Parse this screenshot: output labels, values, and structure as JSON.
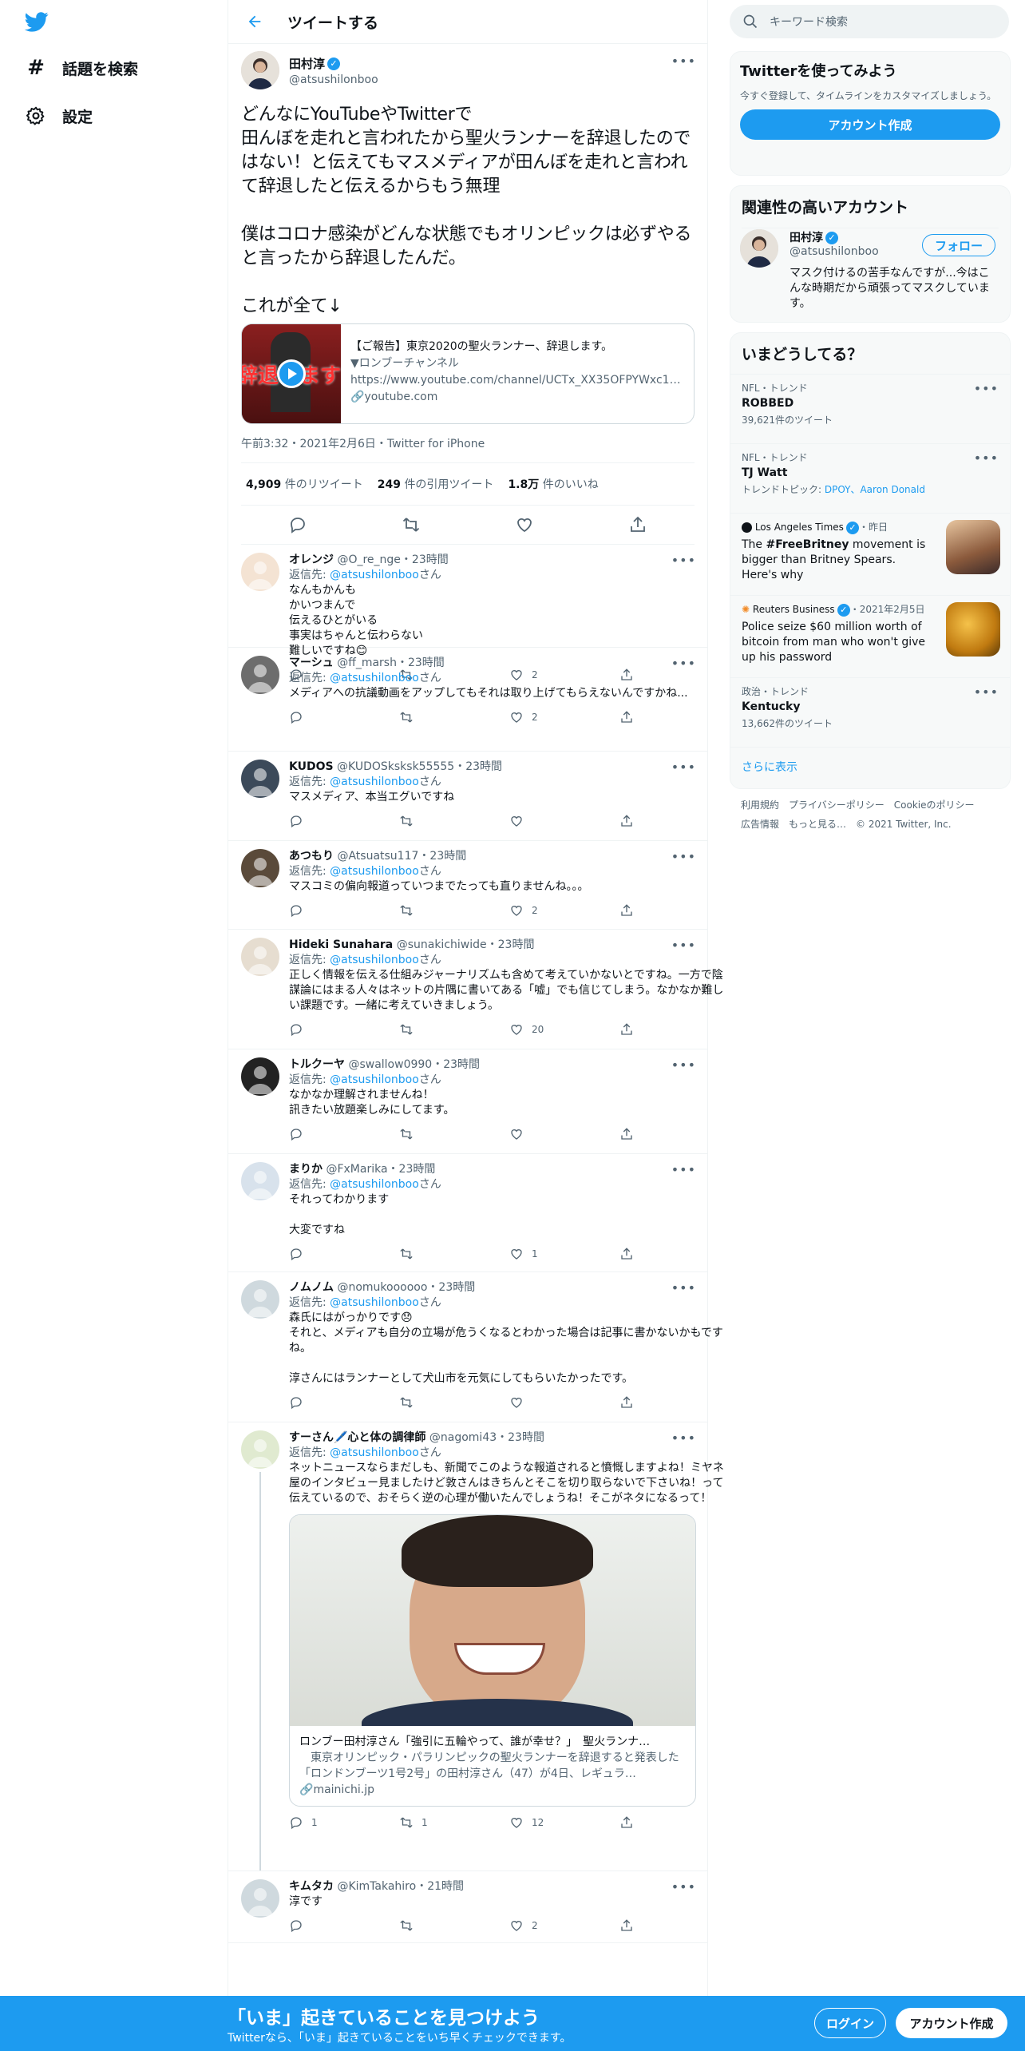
{
  "nav": {
    "explore_label": "話題を検索",
    "settings_label": "設定"
  },
  "header": {
    "title": "ツイートする"
  },
  "main_tweet": {
    "name": "田村淳",
    "handle": "@atsushilonboo",
    "text": "どんなにYouTubeやTwitterで\n田んぼを走れと言われたから聖火ランナーを辞退したのではない！と伝えてもマスメディアが田んぼを走れと言われて辞退したと伝えるからもう無理\n\n僕はコロナ感染がどんな状態でもオリンピックは必ずやると言ったから辞退したんだ。\n\nこれが全て↓",
    "card": {
      "title": "【ご報告】東京2020の聖火ランナー、辞退します。",
      "channel": "▼ロンブーチャンネル",
      "url": "https://www.youtube.com/channel/UCTx_XX35OFPYWxc1qQ…",
      "domain": "youtube.com",
      "thumb_text": "辞退します"
    },
    "meta": "午前3:32・2021年2月6日・Twitter for iPhone",
    "retweets_count": "4,909",
    "retweets_label": "件のリツイート",
    "quotes_count": "249",
    "quotes_label": "件の引用ツイート",
    "likes_count": "1.8万",
    "likes_label": "件のいいね"
  },
  "replies": [
    {
      "name": "オレンジ",
      "handle": "@O_re_nge",
      "time": "・23時間",
      "reply_to": "@atsushilonboo",
      "reply_suffix": "さん",
      "text": "なんもかんも\nかいつまんで\n伝えるひとがいる\n事実はちゃんと伝わらない\n難しいですね😊",
      "comments": "",
      "retweets": "",
      "likes": "2"
    },
    {
      "name": "マーシュ",
      "handle": "@ff_marsh",
      "time": "・23時間",
      "reply_to": "@atsushilonboo",
      "reply_suffix": "さん",
      "text": "メディアへの抗議動画をアップしてもそれは取り上げてもらえないんですかね...",
      "comments": "",
      "retweets": "",
      "likes": "2"
    },
    {
      "name": "KUDOS",
      "handle": "@KUDOSksksk55555",
      "time": "・23時間",
      "reply_to": "@atsushilonboo",
      "reply_suffix": "さん",
      "text": "マスメディア、本当エグいですね",
      "comments": "",
      "retweets": "",
      "likes": ""
    },
    {
      "name": "あつもり",
      "handle": "@Atsuatsu117",
      "time": "・23時間",
      "reply_to": "@atsushilonboo",
      "reply_suffix": "さん",
      "text": "マスコミの偏向報道っていつまでたっても直りませんね。。。",
      "comments": "",
      "retweets": "",
      "likes": "2"
    },
    {
      "name": "Hideki Sunahara",
      "handle": "@sunakichiwide",
      "time": "・23時間",
      "reply_to": "@atsushilonboo",
      "reply_suffix": "さん",
      "text": "正しく情報を伝える仕組みジャーナリズムも含めて考えていかないとですね。一方で陰謀論にはまる人々はネットの片隅に書いてある「嘘」でも信じてしまう。なかなか難しい課題です。一緒に考えていきましょう。",
      "comments": "",
      "retweets": "",
      "likes": "20"
    },
    {
      "name": "トルクーヤ",
      "handle": "@swallow0990",
      "time": "・23時間",
      "reply_to": "@atsushilonboo",
      "reply_suffix": "さん",
      "text": "なかなか理解されませんね！\n訊きたい放題楽しみにしてます。",
      "comments": "",
      "retweets": "",
      "likes": ""
    },
    {
      "name": "まりか",
      "handle": "@FxMarika",
      "time": "・23時間",
      "reply_to": "@atsushilonboo",
      "reply_suffix": "さん",
      "text": "それってわかります\n\n大変ですね",
      "comments": "",
      "retweets": "",
      "likes": "1"
    },
    {
      "name": "ノムノム",
      "handle": "@nomukoooooo",
      "time": "・23時間",
      "reply_to": "@atsushilonboo",
      "reply_suffix": "さん",
      "text": "森氏にはがっかりです😞\nそれと、メディアも自分の立場が危うくなるとわかった場合は記事に書かないかもですね。\n\n淳さんにはランナーとして犬山市を元気にしてもらいたかったです。",
      "comments": "",
      "retweets": "",
      "likes": ""
    },
    {
      "name": "すーさん🖊️心と体の調律師",
      "handle": "@nagomi43",
      "time": "・23時間",
      "reply_to": "@atsushilonboo",
      "reply_suffix": "さん",
      "text": "ネットニュースならまだしも、新聞でこのような報道されると憤慨しますよね！ミヤネ屋のインタビュー見ましたけど敦さんはきちんとそこを切り取らないで下さいね！って伝えているので、おそらく逆の心理が働いたんでしょうね！そこがネタになるって！",
      "comments": "1",
      "retweets": "1",
      "likes": "12",
      "card": {
        "title": "ロンブー田村淳さん「強引に五輪やって、誰が幸せ？」　聖火ランナ…",
        "desc": "　東京オリンピック・パラリンピックの聖火ランナーを辞退すると発表した「ロンドンブーツ1号2号」の田村淳さん（47）が4日、レギュラ…",
        "domain": "mainichi.jp"
      }
    },
    {
      "name": "キムタカ",
      "handle": "@KimTakahiro",
      "time": "・21時間",
      "reply_to": "",
      "reply_suffix": "",
      "text": "淳です",
      "comments": "",
      "retweets": "",
      "likes": "2"
    }
  ],
  "side": {
    "search_placeholder": "キーワード検索",
    "signup": {
      "title": "Twitterを使ってみよう",
      "desc": "今すぐ登録して、タイムラインをカスタマイズしましょう。",
      "button": "アカウント作成"
    },
    "related": {
      "title": "関連性の高いアカウント",
      "name": "田村淳",
      "handle": "@atsushilonboo",
      "follow": "フォロー",
      "bio": "マスク付けるの苦手なんですが...今はこんな時期だから頑張ってマスクしています。"
    },
    "trends": {
      "title": "いまどうしてる？",
      "items": [
        {
          "cat": "NFL・トレンド",
          "title": "ROBBED",
          "sub": "39,621件のツイート"
        },
        {
          "cat": "NFL・トレンド",
          "title": "TJ Watt",
          "sub_prefix": "トレンドトピック: ",
          "sub_links": "DPOY、Aaron Donald"
        },
        {
          "cat": "Los Angeles Times",
          "cat_suffix": "・昨日",
          "title_pre": "The ",
          "title_tag": "#FreeBritney",
          "title_post": " movement is bigger than Britney Spears. Here's why"
        },
        {
          "cat": "Reuters Business",
          "cat_suffix": "・2021年2月5日",
          "title": "Police seize $60 million worth of bitcoin from man who won't give up his password"
        },
        {
          "cat": "政治・トレンド",
          "title": "Kentucky",
          "sub": "13,662件のツイート"
        }
      ],
      "show_more": "さらに表示"
    },
    "footer": {
      "line1": "利用規約　プライバシーポリシー　Cookieのポリシー",
      "line2": "広告情報　もっと見る…　© 2021 Twitter, Inc."
    }
  },
  "bottom": {
    "title": "「いま」起きていることを見つけよう",
    "sub": "Twitterなら、「いま」起きていることをいち早くチェックできます。",
    "login": "ログイン",
    "signup": "アカウント作成"
  },
  "colors": {
    "accent": "#1d9bf0",
    "text": "#0f1419",
    "muted": "#536471"
  }
}
